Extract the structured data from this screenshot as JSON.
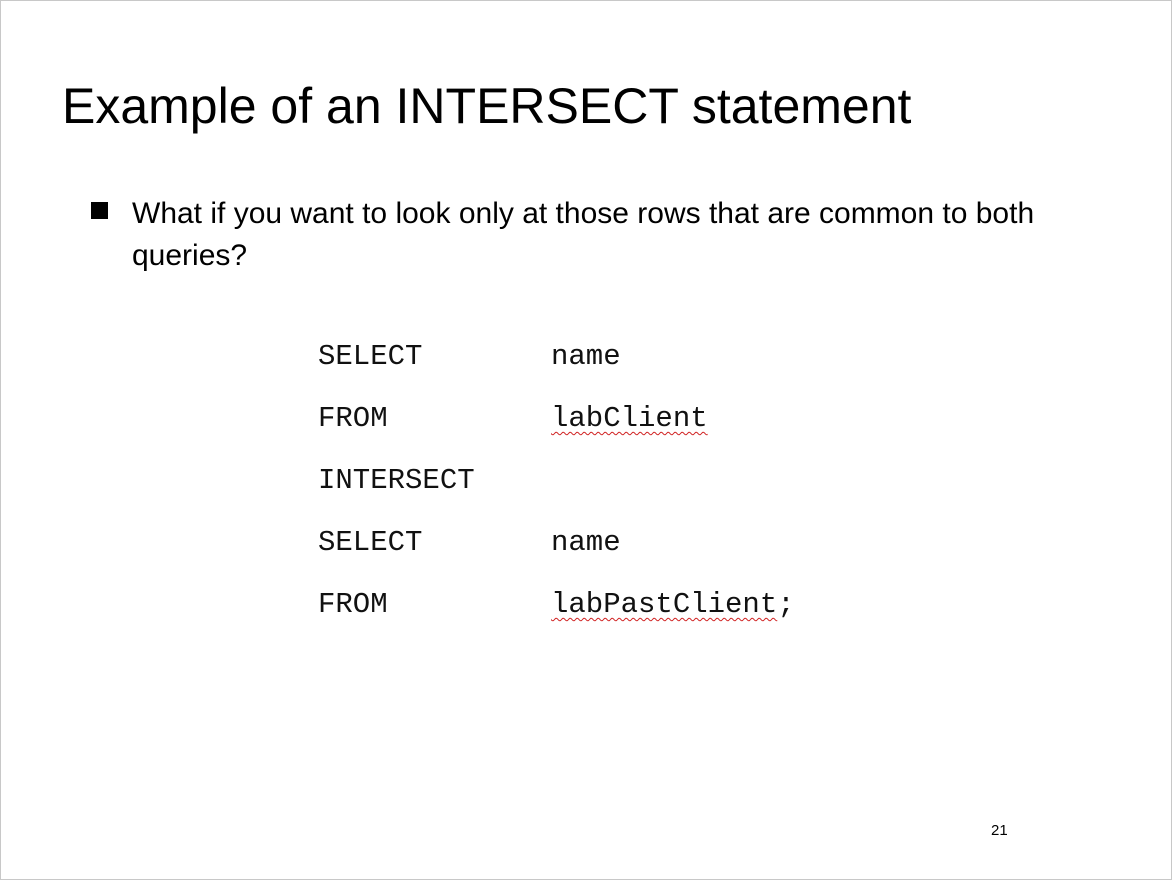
{
  "slide": {
    "title": "Example of an INTERSECT statement",
    "bullet": "What if you want to look only at those rows that are common to both queries?",
    "code_lines": [
      {
        "keyword": "SELECT",
        "identifier": "name"
      },
      {
        "keyword": "FROM",
        "identifier": "labClient"
      },
      {
        "keyword": "INTERSECT",
        "identifier": ""
      },
      {
        "keyword": "SELECT",
        "identifier": "name"
      },
      {
        "keyword": "FROM",
        "identifier": "labPastClient",
        "terminator": ";"
      }
    ],
    "page_number": "21"
  },
  "colors": {
    "text": "#000000",
    "spellcheck_underline": "#d02020",
    "border": "#c8c8c8"
  },
  "icons": {
    "bullet": "square-bullet-icon"
  }
}
